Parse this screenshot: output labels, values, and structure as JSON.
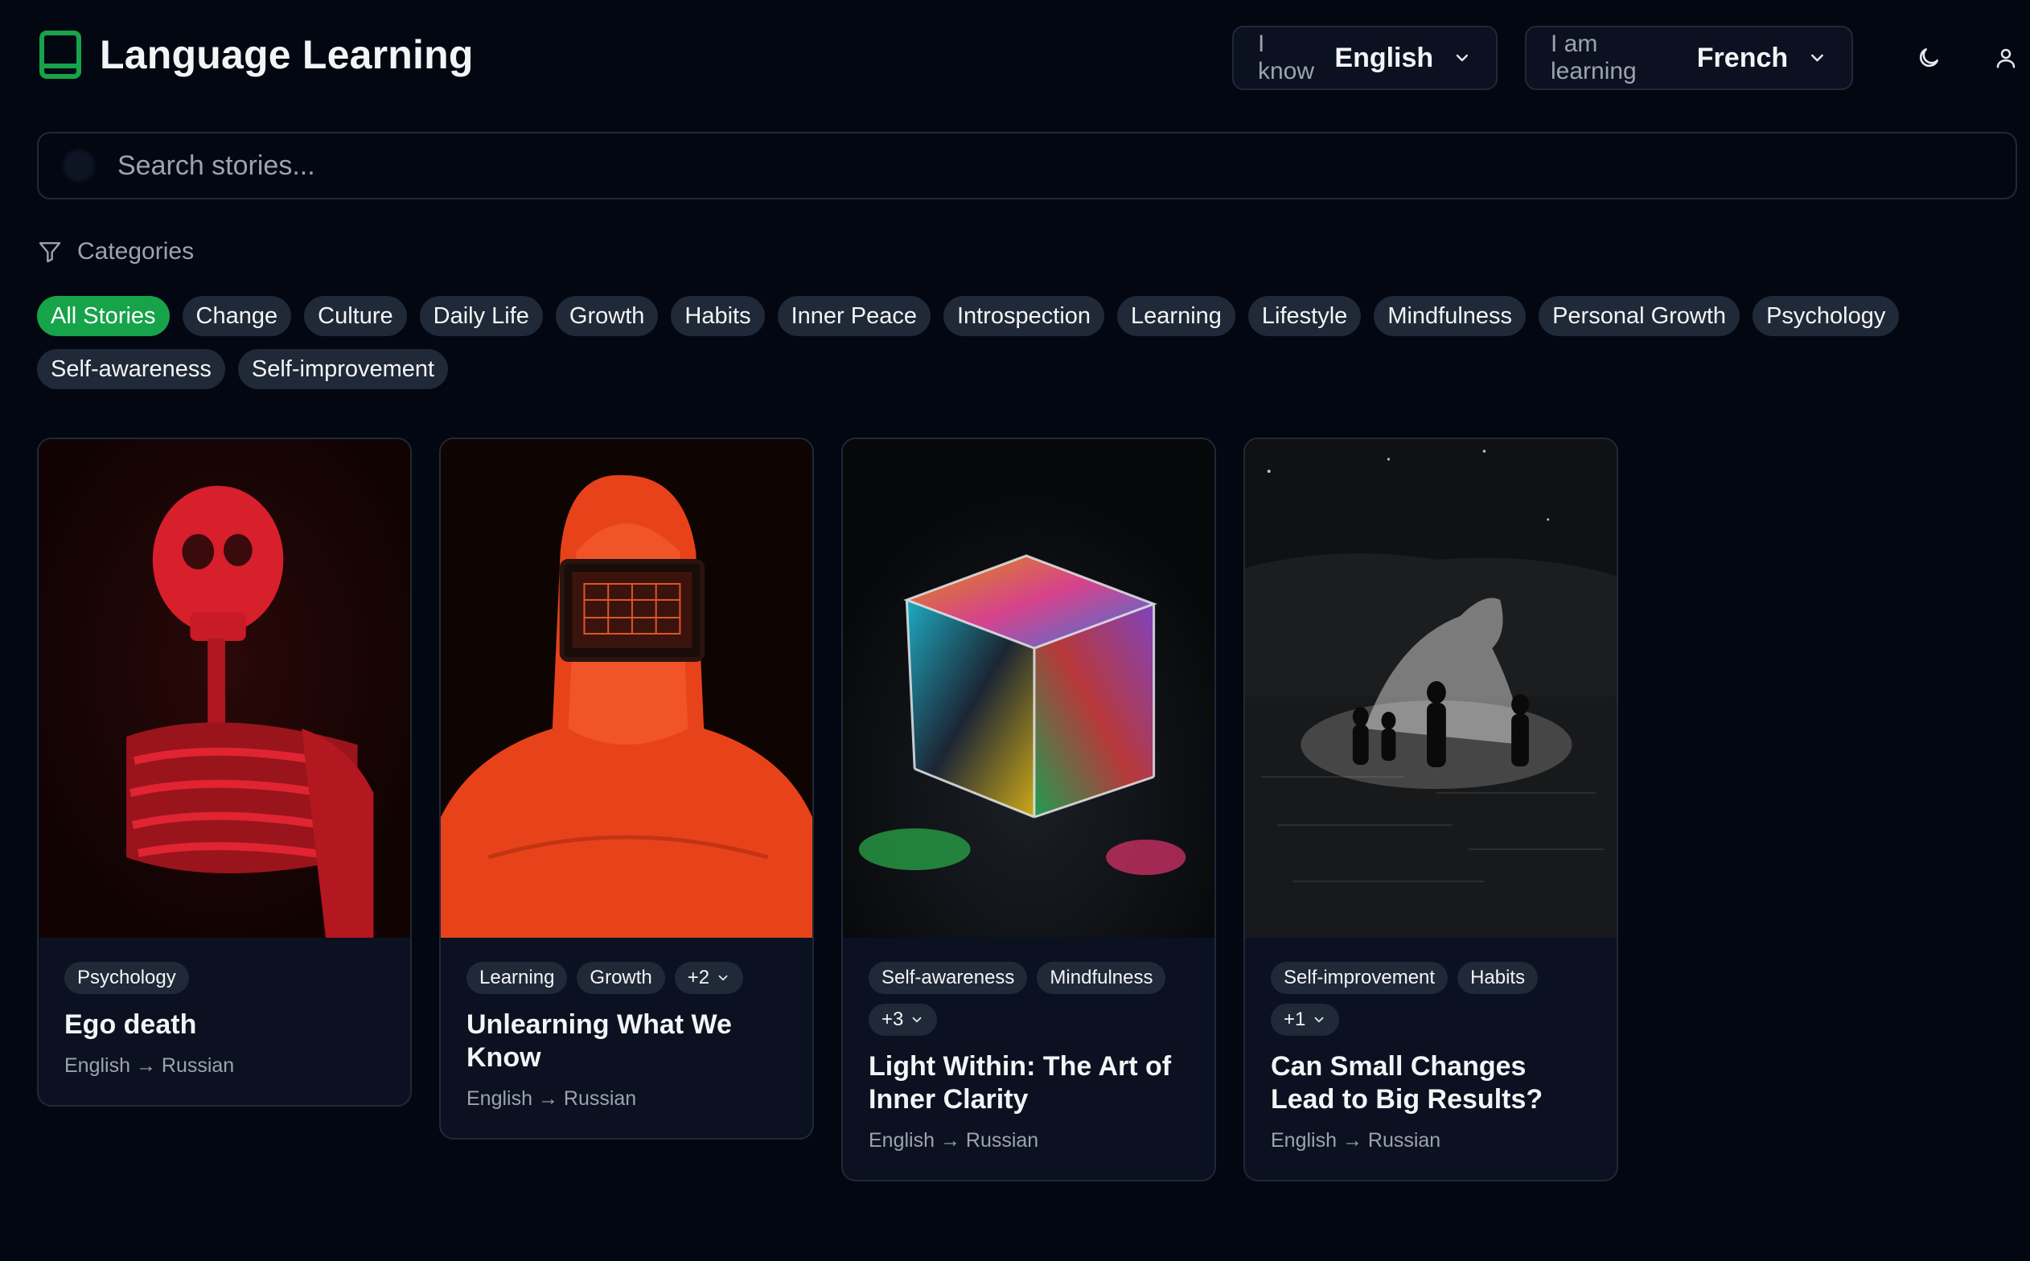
{
  "app": {
    "title": "Language Learning",
    "accent": "#16a34a"
  },
  "header": {
    "know": {
      "prefix": "I know",
      "value": "English"
    },
    "learning": {
      "prefix": "I am learning",
      "value": "French"
    },
    "icons": [
      "book-icon",
      "chevron-down-icon",
      "moon-icon",
      "user-icon"
    ]
  },
  "search": {
    "placeholder": "Search stories...",
    "value": ""
  },
  "categories": {
    "label": "Categories",
    "items": [
      "All Stories",
      "Change",
      "Culture",
      "Daily Life",
      "Growth",
      "Habits",
      "Inner Peace",
      "Introspection",
      "Learning",
      "Lifestyle",
      "Mindfulness",
      "Personal Growth",
      "Psychology",
      "Self-awareness",
      "Self-improvement"
    ],
    "selected": "All Stories"
  },
  "stories": [
    {
      "tags": [
        "Psychology"
      ],
      "more": "",
      "title": "Ego death",
      "langs": "English → Russian",
      "image": "red-skeleton"
    },
    {
      "tags": [
        "Learning",
        "Growth"
      ],
      "more": "+2",
      "title": "Unlearning What We Know",
      "langs": "English → Russian",
      "image": "orange-figure-with-screen"
    },
    {
      "tags": [
        "Self-awareness",
        "Mindfulness"
      ],
      "more": "+3",
      "title": "Light Within: The Art of Inner Clarity",
      "langs": "English → Russian",
      "image": "prism-cube"
    },
    {
      "tags": [
        "Self-improvement",
        "Habits"
      ],
      "more": "+1",
      "title": "Can Small Changes Lead to Big Results?",
      "langs": "English → Russian",
      "image": "ghost-figures-in-water"
    }
  ]
}
